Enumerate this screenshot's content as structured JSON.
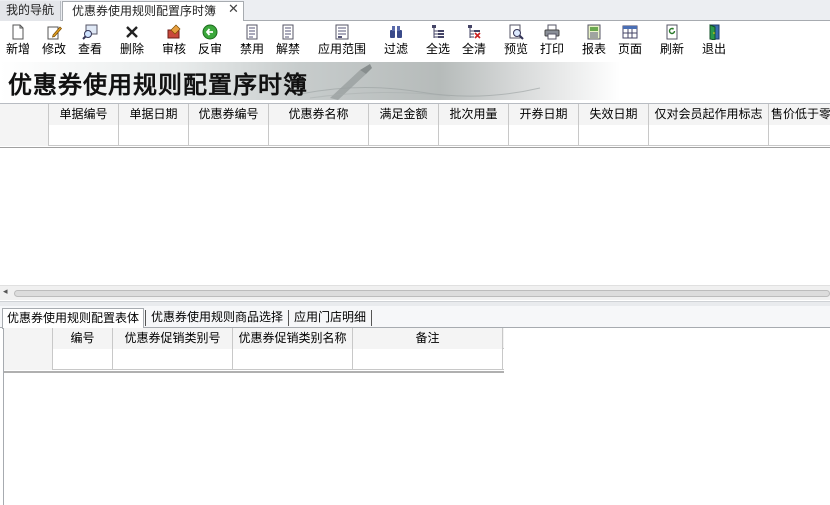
{
  "tabs": [
    {
      "label": "我的导航"
    },
    {
      "label": "优惠券使用规则配置序时簿"
    }
  ],
  "toolbar": {
    "buttons": [
      {
        "label": "新增",
        "icon": "new-doc-icon"
      },
      {
        "label": "修改",
        "icon": "edit-icon"
      },
      {
        "label": "查看",
        "icon": "view-icon"
      },
      {
        "label": "删除",
        "icon": "delete-x-icon"
      },
      {
        "label": "审核",
        "icon": "approve-icon"
      },
      {
        "label": "反审",
        "icon": "unapprove-icon"
      },
      {
        "label": "禁用",
        "icon": "disable-icon"
      },
      {
        "label": "解禁",
        "icon": "enable-icon"
      },
      {
        "label": "应用范围",
        "icon": "scope-icon"
      },
      {
        "label": "过滤",
        "icon": "filter-binoculars-icon"
      },
      {
        "label": "全选",
        "icon": "select-all-icon"
      },
      {
        "label": "全清",
        "icon": "clear-all-icon"
      },
      {
        "label": "预览",
        "icon": "preview-icon"
      },
      {
        "label": "打印",
        "icon": "print-icon"
      },
      {
        "label": "报表",
        "icon": "report-icon"
      },
      {
        "label": "页面",
        "icon": "page-icon"
      },
      {
        "label": "刷新",
        "icon": "refresh-icon"
      },
      {
        "label": "退出",
        "icon": "exit-icon"
      }
    ]
  },
  "banner": {
    "title": "优惠券使用规则配置序时簿"
  },
  "main_grid": {
    "columns": [
      "单据编号",
      "单据日期",
      "优惠券编号",
      "优惠券名称",
      "满足金额",
      "批次用量",
      "开券日期",
      "失效日期",
      "仅对会员起作用标志",
      "售价低于零"
    ]
  },
  "sub_tabs": [
    {
      "label": "优惠券使用规则配置表体"
    },
    {
      "label": "优惠券使用规则商品选择"
    },
    {
      "label": "应用门店明细"
    }
  ],
  "sub_grid": {
    "columns": [
      "编号",
      "优惠券促销类别号",
      "优惠券促销类别名称",
      "备注"
    ]
  },
  "colors": {
    "accent_green": "#2f9a2f",
    "header_bg": "#f4f4f4",
    "border": "#c8c8c8"
  }
}
